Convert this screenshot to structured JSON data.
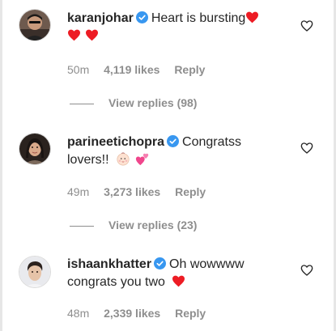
{
  "colors": {
    "text": "#262626",
    "muted": "#8e8e8e",
    "verified_blue": "#3897f0",
    "heart_red": "#ed1c24"
  },
  "comments": [
    {
      "username": "karanjohar",
      "text": "Heart is bursting",
      "time": "50m",
      "likes": "4,119 likes",
      "reply": "Reply",
      "view_replies": "View replies (98)",
      "emojis": [
        "red-heart",
        "red-heart",
        "red-heart"
      ]
    },
    {
      "username": "parineetichopra",
      "text": "Congratss lovers!!",
      "time": "49m",
      "likes": "3,273 likes",
      "reply": "Reply",
      "view_replies": "View replies (23)",
      "emojis": [
        "baby-face",
        "two-hearts"
      ]
    },
    {
      "username": "ishaankhatter",
      "text": "Oh wowwww congrats you two",
      "time": "48m",
      "likes": "2,339 likes",
      "reply": "Reply",
      "emojis": [
        "red-heart"
      ]
    }
  ]
}
